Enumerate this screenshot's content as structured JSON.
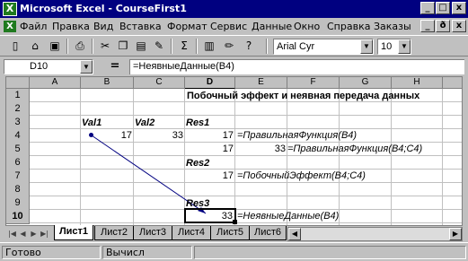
{
  "window": {
    "title": "Microsoft Excel - CourseFirst1",
    "app_icon": "excel-icon",
    "minimize": "_",
    "maximize": "□",
    "close": "x",
    "doc_minimize": "_",
    "doc_restore": "ð",
    "doc_close": "x"
  },
  "menu": {
    "items": [
      "Файл",
      "Правка",
      "Вид",
      "Вставка",
      "Формат",
      "Сервис",
      "Данные",
      "Окно",
      "Справка",
      "Заказы"
    ]
  },
  "toolbar": {
    "buttons": [
      {
        "icon": "new-doc-icon",
        "glyph": "▯"
      },
      {
        "icon": "open-folder-icon",
        "glyph": "⌂"
      },
      {
        "icon": "save-icon",
        "glyph": "▣"
      },
      {
        "icon": "print-icon",
        "glyph": "⎙"
      },
      {
        "icon": "preview-icon",
        "glyph": "⌕"
      },
      {
        "icon": "cut-icon",
        "glyph": "✂"
      },
      {
        "icon": "copy-icon",
        "glyph": "❐"
      },
      {
        "icon": "paste-icon",
        "glyph": "▤"
      },
      {
        "icon": "format-painter-icon",
        "glyph": "✎"
      },
      {
        "icon": "autosum-icon",
        "glyph": "Σ"
      },
      {
        "icon": "chart-wizard-icon",
        "glyph": "▥"
      },
      {
        "icon": "drawing-icon",
        "glyph": "✏"
      },
      {
        "icon": "help-icon",
        "glyph": "?"
      }
    ],
    "font_name": "Arial Cyr",
    "font_size": "10"
  },
  "formula_bar": {
    "cell_ref": "D10",
    "equals": "=",
    "formula": "=НеявныеДанные(B4)"
  },
  "grid": {
    "columns": [
      "A",
      "B",
      "C",
      "D",
      "E",
      "F",
      "G",
      "H"
    ],
    "selected_column": "D",
    "rows": [
      "1",
      "2",
      "3",
      "4",
      "5",
      "6",
      "7",
      "8",
      "9",
      "10"
    ],
    "selected_row": "10",
    "cells": {
      "D1": "Побочный эффект и неявная передача данных",
      "B3": "Val1",
      "C3": "Val2",
      "D3": "Res1",
      "B4": "17",
      "C4": "33",
      "D4": "17",
      "E4": "=ПравильнаяФункция(B4)",
      "D5": "17",
      "E5": "33",
      "F5": "=ПравильнаяФункция(B4;C4)",
      "D6": "Res2",
      "D7": "17",
      "E7": "=ПобочныйЭффект(B4;C4)",
      "D9": "Res3",
      "D10": "33",
      "E10": "=НеявныеДанные(B4)"
    }
  },
  "sheet_tabs": {
    "tabs": [
      "Лист1",
      "Лист2",
      "Лист3",
      "Лист4",
      "Лист5",
      "Лист6"
    ],
    "active": "Лист1"
  },
  "status": {
    "ready": "Готово",
    "calc": "Вычисл"
  }
}
